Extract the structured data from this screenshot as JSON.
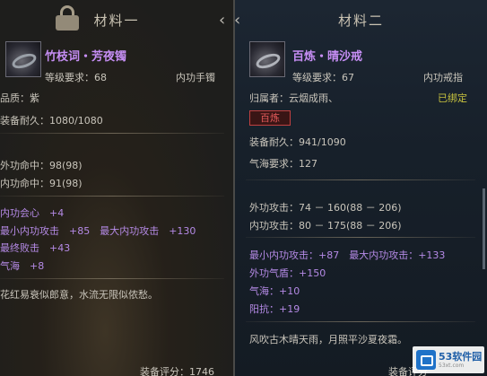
{
  "left": {
    "title": "材料一",
    "item_name": "竹枝词・芳夜镯",
    "level_req": "等级要求：68",
    "item_type": "内功手镯",
    "quality": "品质：紫",
    "durability": "装备耐久：1080/1080",
    "stats": [
      "外功命中：98(98)",
      "内功命中：91(98)"
    ],
    "bonuses": [
      "内功会心　+4",
      "最小内功攻击　+85　最大内功攻击　+130",
      "最终败击　+43",
      "气海　+8"
    ],
    "flavor": "花红易衰似郎意，水流无限似侬愁。",
    "score": "装备评分：1746"
  },
  "right": {
    "title": "材料二",
    "item_name": "百炼・晴沙戒",
    "level_req": "等级要求：67",
    "item_type": "内功戒指",
    "owner": "归属者：云烟成雨、",
    "bound": "已绑定",
    "tag": "百炼",
    "durability": "装备耐久：941/1090",
    "qihai_req": "气海要求：127",
    "attacks": [
      "外功攻击：74 － 160(88 － 206)",
      "内功攻击：80 － 175(88 － 206)"
    ],
    "bonuses": [
      "最小内功攻击：+87　最大内功攻击：+133",
      "外功气盾：+150",
      "气海：+10",
      "阳抗：+19"
    ],
    "flavor": "风吹古木晴天雨，月照平沙夏夜霜。",
    "score": "装备评分"
  },
  "watermark": {
    "brand": "53软件园",
    "url": "53xt.com"
  },
  "colors": {
    "item_name": "#c68ef4",
    "bonus": "#b58ae6",
    "bound": "#c7c23e",
    "tag_border": "#c04040"
  },
  "icons": [
    "lock-icon",
    "chevron-left-icon",
    "bracelet-item-icon",
    "ring-item-icon"
  ]
}
